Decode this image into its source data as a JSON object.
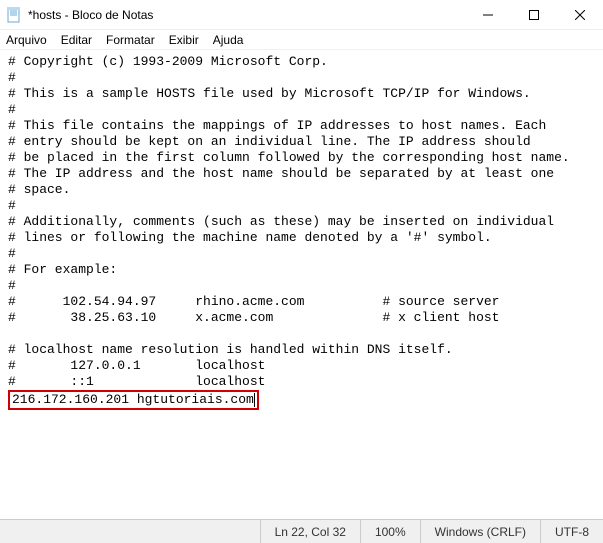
{
  "window": {
    "title": "*hosts - Bloco de Notas"
  },
  "menubar": {
    "file": "Arquivo",
    "edit": "Editar",
    "format": "Formatar",
    "view": "Exibir",
    "help": "Ajuda"
  },
  "content": {
    "lines": [
      "# Copyright (c) 1993-2009 Microsoft Corp.",
      "#",
      "# This is a sample HOSTS file used by Microsoft TCP/IP for Windows.",
      "#",
      "# This file contains the mappings of IP addresses to host names. Each",
      "# entry should be kept on an individual line. The IP address should",
      "# be placed in the first column followed by the corresponding host name.",
      "# The IP address and the host name should be separated by at least one",
      "# space.",
      "#",
      "# Additionally, comments (such as these) may be inserted on individual",
      "# lines or following the machine name denoted by a '#' symbol.",
      "#",
      "# For example:",
      "#",
      "#      102.54.94.97     rhino.acme.com          # source server",
      "#       38.25.63.10     x.acme.com              # x client host",
      "",
      "# localhost name resolution is handled within DNS itself.",
      "#       127.0.0.1       localhost",
      "#       ::1             localhost"
    ],
    "highlighted_line": "216.172.160.201 hgtutoriais.com"
  },
  "statusbar": {
    "position": "Ln 22, Col 32",
    "zoom": "100%",
    "line_ending": "Windows (CRLF)",
    "encoding": "UTF-8"
  }
}
